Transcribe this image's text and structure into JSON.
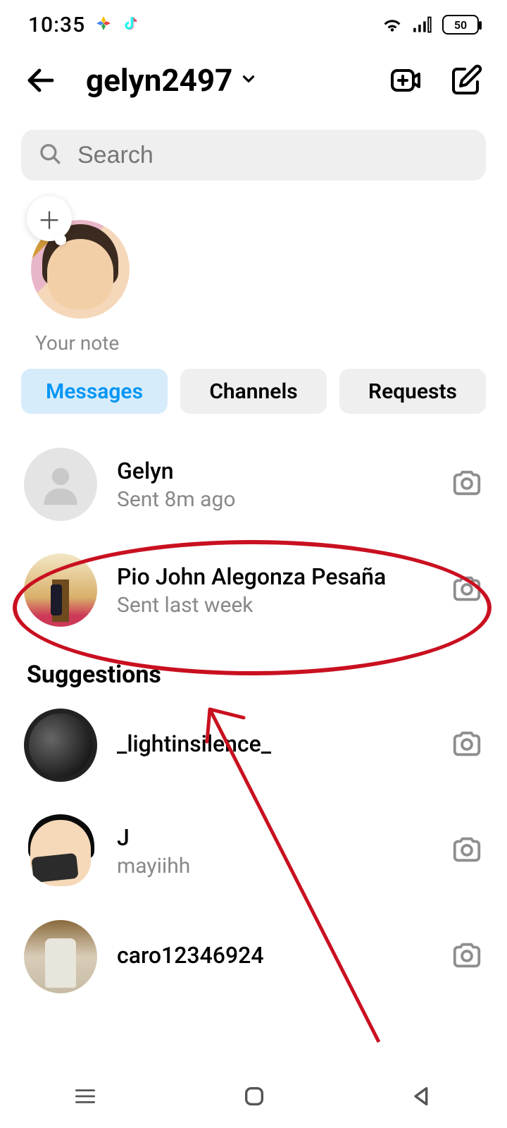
{
  "status": {
    "time": "10:35",
    "battery": "50"
  },
  "header": {
    "username": "gelyn2497"
  },
  "search": {
    "placeholder": "Search"
  },
  "note": {
    "label": "Your note"
  },
  "tabs": {
    "messages": "Messages",
    "channels": "Channels",
    "requests": "Requests"
  },
  "conversations": [
    {
      "name": "Gelyn",
      "subtitle": "Sent 8m ago"
    },
    {
      "name": "Pio John Alegonza Pesaña",
      "subtitle": "Sent last week"
    }
  ],
  "suggestions_title": "Suggestions",
  "suggestions": [
    {
      "name": "_lightinsilence_",
      "subtitle": ""
    },
    {
      "name": "J",
      "subtitle": "mayiihh"
    },
    {
      "name": "caro12346924",
      "subtitle": ""
    }
  ]
}
